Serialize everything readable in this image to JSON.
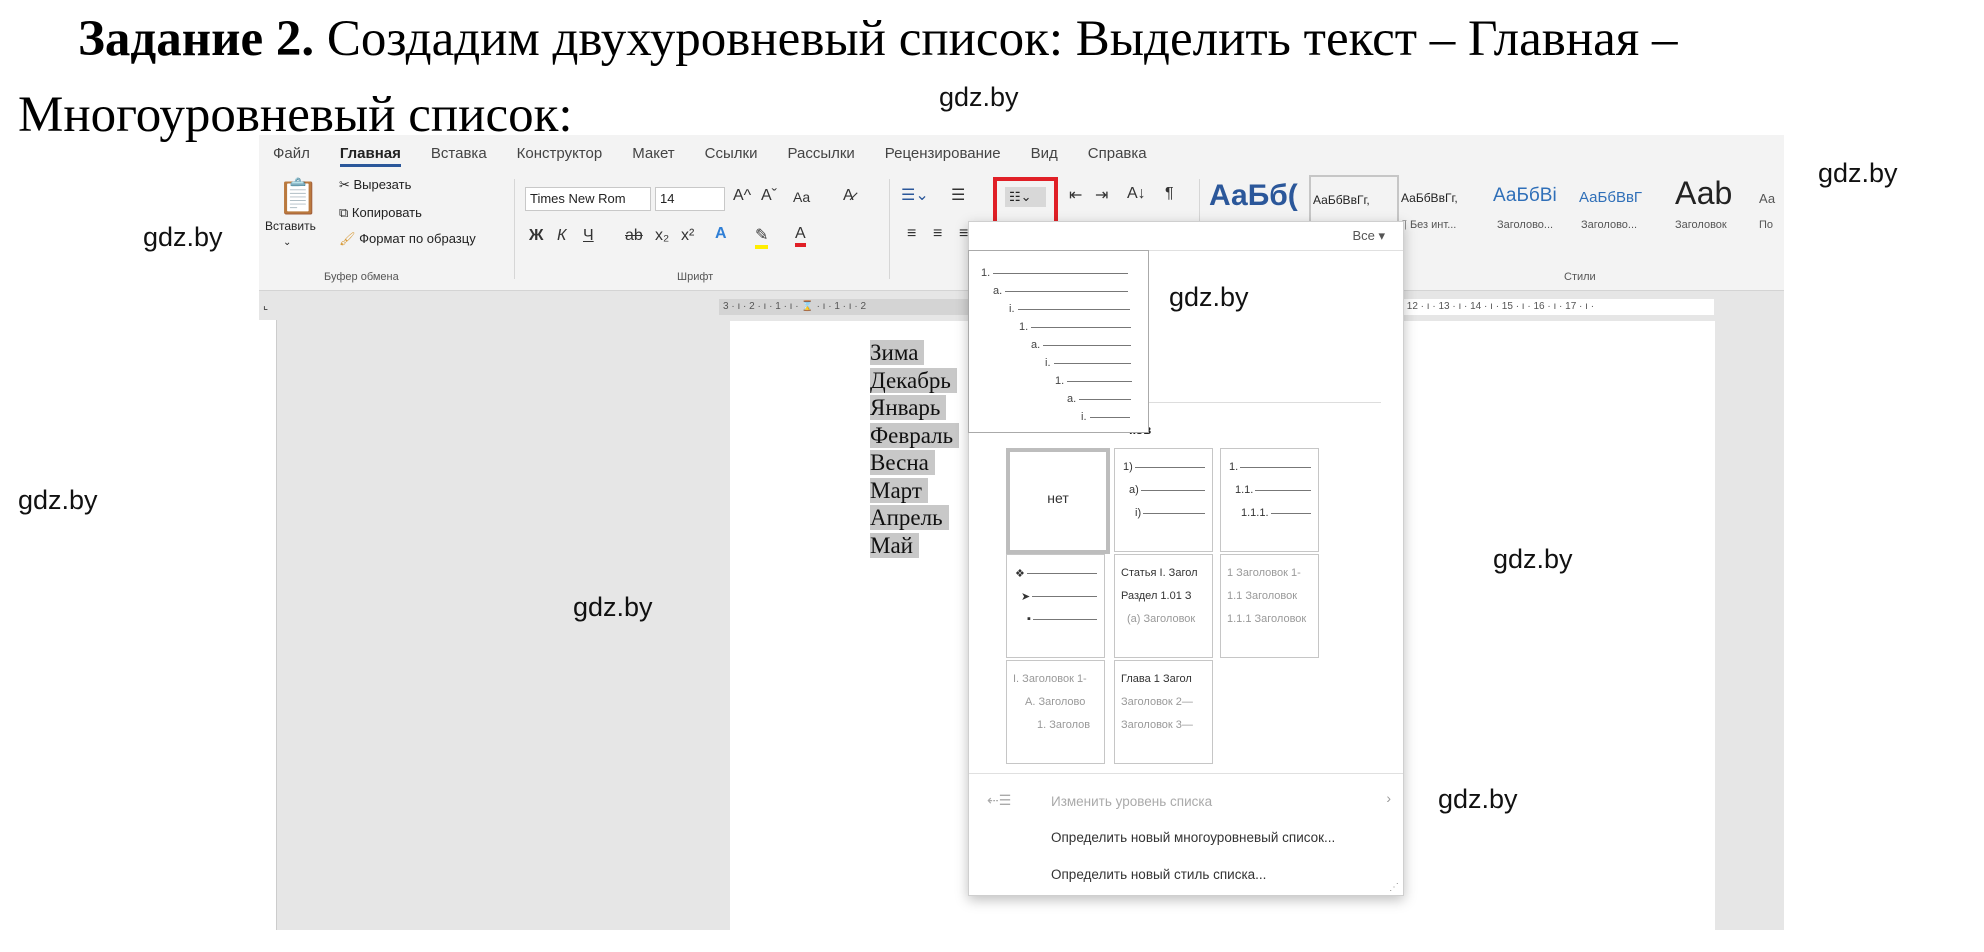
{
  "task": {
    "label": "Задание 2.",
    "text_line1": " Создадим двухуровневый список: Выделить текст – Главная –",
    "text_line2": "Многоуровневый список:"
  },
  "watermark": "gdz.by",
  "menu_tabs": [
    "Файл",
    "Главная",
    "Вставка",
    "Конструктор",
    "Макет",
    "Ссылки",
    "Рассылки",
    "Рецензирование",
    "Вид",
    "Справка"
  ],
  "active_tab": "Главная",
  "clipboard": {
    "paste": "Вставить",
    "cut": "Вырезать",
    "copy": "Копировать",
    "format_painter": "Формат по образцу",
    "group": "Буфер обмена"
  },
  "font": {
    "name": "Times New Rom",
    "size": "14",
    "group": "Шрифт",
    "bold": "Ж",
    "italic": "К",
    "underline": "Ч",
    "case": "Aa",
    "sub": "x₂",
    "sup": "x²",
    "grow": "A^",
    "shrink": "Aˇ"
  },
  "styles": {
    "group": "Стили",
    "filter": "Все ▾",
    "items": [
      {
        "sample": "АаБб(",
        "label": ""
      },
      {
        "sample": "АаБбВвГг,",
        "label": ""
      },
      {
        "sample": "АаБбВвГг,",
        "label": "¶ Без инт..."
      },
      {
        "sample": "АаБбВі",
        "label": "Заголово..."
      },
      {
        "sample": "АаБбВвГ",
        "label": "Заголово..."
      },
      {
        "sample": "Ааb",
        "label": "Заголовок"
      },
      {
        "sample": "Аа",
        "label": "По"
      }
    ]
  },
  "ruler": {
    "left": "3 · ı · 2 · ı · 1 · ı · ⌛ · ı · 1 · ı · 2",
    "right": "· ı · 12 · ı · 13 · ı · 14 · ı · 15 · ı · 16 · ı · 17 · ı ·"
  },
  "document": {
    "lines": [
      "Зима",
      "Декабрь",
      "Январь",
      "Февраль",
      "Весна",
      "Март",
      "Апрель",
      "Май"
    ]
  },
  "preview_levels": [
    "1.",
    "a.",
    "i.",
    "1.",
    "a.",
    "i.",
    "1.",
    "a.",
    "i."
  ],
  "library": {
    "heading_partial": "ков",
    "tiles": [
      {
        "lines": [
          "нет"
        ]
      },
      {
        "lines": [
          "1)",
          "a)",
          "i)"
        ]
      },
      {
        "lines": [
          "1.",
          "1.1.",
          "1.1.1."
        ]
      },
      {
        "lines": [
          "❖",
          "➤",
          "▪"
        ]
      },
      {
        "lines": [
          "Статья I. Загол",
          "Раздел 1.01 З",
          "(a) Заголовок"
        ]
      },
      {
        "lines": [
          "1 Заголовок 1-",
          "1.1 Заголовок",
          "1.1.1 Заголовок"
        ]
      },
      {
        "lines": [
          "I. Заголовок 1-",
          "A. Заголово",
          "1. Заголов"
        ]
      },
      {
        "lines": [
          "Глава 1 Загол",
          "Заголовок 2—",
          "Заголовок 3—"
        ]
      }
    ]
  },
  "menu": {
    "change_level": "Изменить уровень списка",
    "define_multilevel": "Определить новый многоуровневый список...",
    "define_style": "Определить новый стиль списка..."
  },
  "colors": {
    "accent": "#2b579a",
    "highlight_box": "#e01f26",
    "selection": "#c8c8c8"
  }
}
